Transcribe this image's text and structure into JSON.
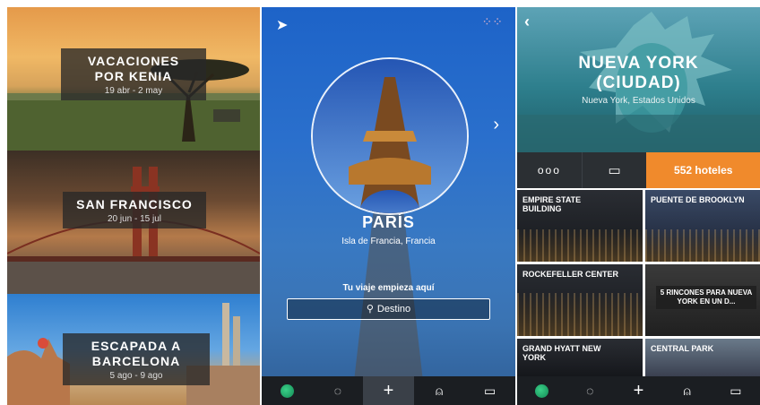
{
  "trips": [
    {
      "title_line1": "VACACIONES",
      "title_line2": "POR KENIA",
      "dates": "19 abr - 2 may"
    },
    {
      "title_line1": "SAN FRANCISCO",
      "title_line2": "",
      "dates": "20 jun - 15 jul"
    },
    {
      "title_line1": "ESCAPADA A",
      "title_line2": "BARCELONA",
      "dates": "5 ago - 9 ago"
    }
  ],
  "home": {
    "city": "PARÍS",
    "region": "Isla de Francia, Francia",
    "start_text": "Tu viaje empieza aquí",
    "search_placeholder": "Destino",
    "icons": {
      "top_left": "location-arrow-icon",
      "top_right": "grid-icon",
      "next": "chevron-right-icon"
    }
  },
  "tabbar": [
    {
      "name": "globe-icon",
      "glyph": ""
    },
    {
      "name": "lightbulb-icon",
      "glyph": "💡"
    },
    {
      "name": "add-icon",
      "glyph": "+"
    },
    {
      "name": "user-icon",
      "glyph": "👤"
    },
    {
      "name": "folder-icon",
      "glyph": "🗀"
    }
  ],
  "city": {
    "title_line1": "NUEVA YORK",
    "title_line2": "(CIUDAD)",
    "subtitle": "Nueva York, Estados Unidos",
    "hotels_label": "552 hoteles",
    "hotels_color": "#f08a2c",
    "tiles": [
      {
        "label": "EMPIRE STATE BUILDING"
      },
      {
        "label": "PUENTE DE BROOKLYN"
      },
      {
        "label": "ROCKEFELLER CENTER"
      },
      {
        "label": "5 RINCONES PARA NUEVA YORK EN UN D..."
      },
      {
        "label": "GRAND HYATT NEW YORK"
      },
      {
        "label": "CENTRAL PARK"
      }
    ]
  }
}
